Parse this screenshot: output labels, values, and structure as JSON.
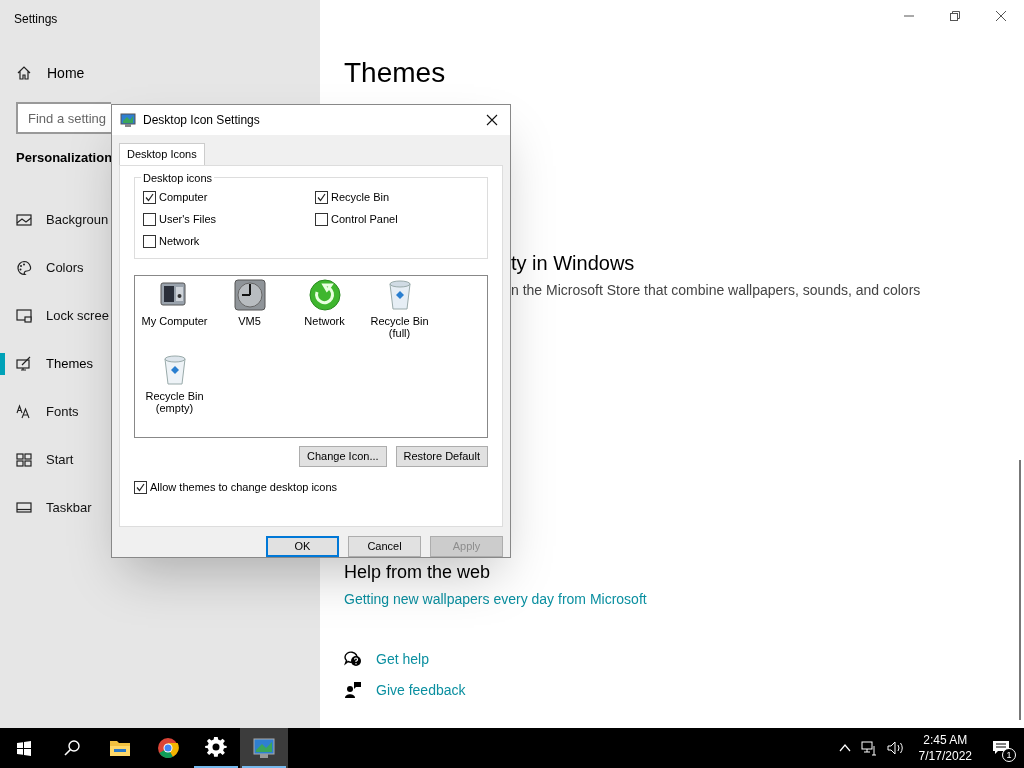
{
  "window": {
    "title": "Settings"
  },
  "sidebar": {
    "home": "Home",
    "search": {
      "placeholder": "Find a setting"
    },
    "section": "Personalization",
    "items": [
      {
        "label": "Backgroun",
        "selected": false
      },
      {
        "label": "Colors",
        "selected": false
      },
      {
        "label": "Lock scree",
        "selected": false
      },
      {
        "label": "Themes",
        "selected": true
      },
      {
        "label": "Fonts",
        "selected": false
      },
      {
        "label": "Start",
        "selected": false
      },
      {
        "label": "Taskbar",
        "selected": false
      }
    ]
  },
  "main": {
    "title": "Themes",
    "section_heading": "ty in Windows",
    "description": "n the Microsoft Store that combine wallpapers, sounds, and colors",
    "help_heading": "Help from the web",
    "help_link": "Getting new wallpapers every day from Microsoft",
    "links": [
      {
        "label": "Get help"
      },
      {
        "label": "Give feedback"
      }
    ]
  },
  "dialog": {
    "title": "Desktop Icon Settings",
    "tabs": [
      {
        "label": "Desktop Icons",
        "selected": true
      }
    ],
    "group_label": "Desktop icons",
    "checkboxes": [
      {
        "label": "Computer",
        "checked": true
      },
      {
        "label": "Recycle Bin",
        "checked": true
      },
      {
        "label": "User's Files",
        "checked": false
      },
      {
        "label": "Control Panel",
        "checked": false
      },
      {
        "label": "Network",
        "checked": false
      }
    ],
    "icons": [
      {
        "label": "My Computer",
        "selected": false
      },
      {
        "label": "VM5",
        "selected": false
      },
      {
        "label": "Network",
        "selected": false
      },
      {
        "label": "Recycle Bin\n(full)",
        "selected": false
      },
      {
        "label": "Recycle Bin\n(empty)",
        "selected": false
      }
    ],
    "icon_buttons": [
      "Change Icon...",
      "Restore Default"
    ],
    "allow_themes": {
      "label": "Allow themes to change desktop icons",
      "checked": true
    },
    "buttons": [
      {
        "label": "OK",
        "default": true,
        "disabled": false
      },
      {
        "label": "Cancel",
        "default": false,
        "disabled": false
      },
      {
        "label": "Apply",
        "default": false,
        "disabled": true
      }
    ]
  },
  "taskbar": {
    "apps": [
      {
        "running": false,
        "active": false
      },
      {
        "running": false,
        "active": false
      },
      {
        "running": false,
        "active": false
      },
      {
        "running": false,
        "active": false
      },
      {
        "running": true,
        "active": false
      },
      {
        "running": true,
        "active": true
      }
    ],
    "time": "2:45 AM",
    "date": "7/17/2022",
    "notification_count": "1"
  }
}
